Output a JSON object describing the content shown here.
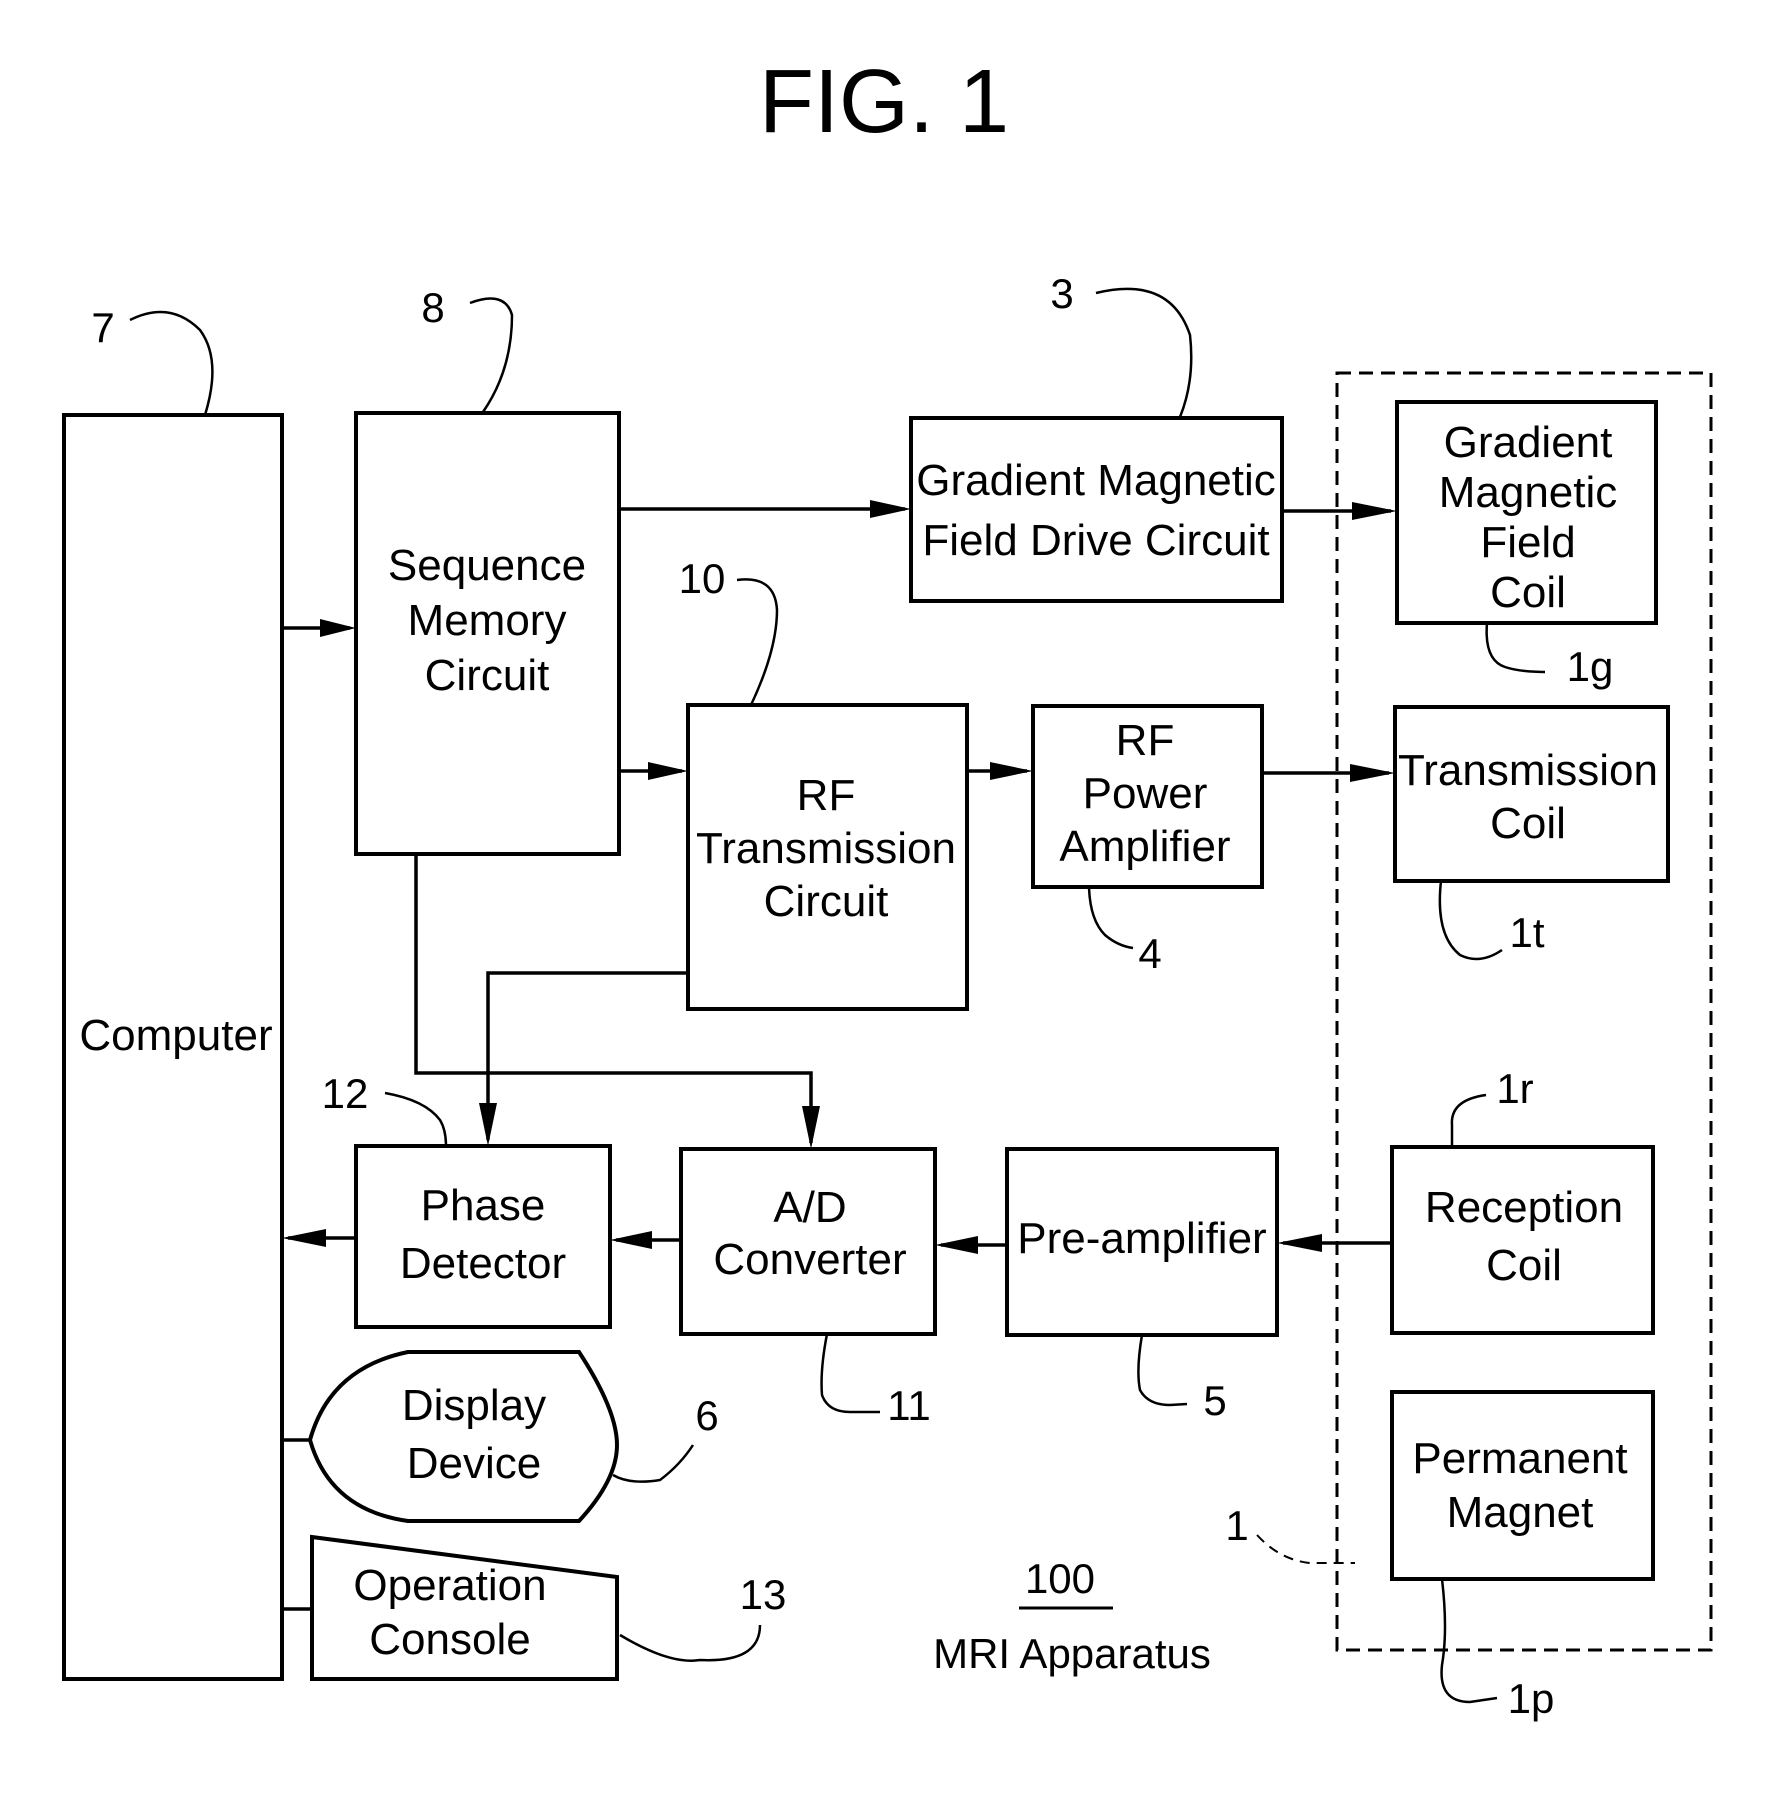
{
  "figure": {
    "title": "FIG. 1",
    "apparatus_number": "100",
    "apparatus_name": "MRI Apparatus"
  },
  "blocks": {
    "computer": {
      "label": [
        "Computer"
      ],
      "ref": "7"
    },
    "sequence_memory": {
      "label": [
        "Sequence",
        "Memory",
        "Circuit"
      ],
      "ref": "8"
    },
    "gradient_drive": {
      "label": [
        "Gradient Magnetic",
        "Field Drive Circuit"
      ],
      "ref": "3"
    },
    "rf_transmission": {
      "label": [
        "RF",
        "Transmission",
        "Circuit"
      ],
      "ref": "10"
    },
    "rf_power_amp": {
      "label": [
        "RF",
        "Power",
        "Amplifier"
      ],
      "ref": "4"
    },
    "gradient_coil": {
      "label": [
        "Gradient",
        "Magnetic",
        "Field",
        "Coil"
      ],
      "ref": "1g"
    },
    "transmission_coil": {
      "label": [
        "Transmission",
        "Coil"
      ],
      "ref": "1t"
    },
    "reception_coil": {
      "label": [
        "Reception",
        "Coil"
      ],
      "ref": "1r"
    },
    "permanent_magnet": {
      "label": [
        "Permanent",
        "Magnet"
      ],
      "ref": "1p"
    },
    "phase_detector": {
      "label": [
        "Phase",
        "Detector"
      ],
      "ref": "12"
    },
    "ad_converter": {
      "label": [
        "A/D",
        "Converter"
      ],
      "ref": "11"
    },
    "preamplifier": {
      "label": [
        "Pre-amplifier"
      ],
      "ref": "5"
    },
    "display_device": {
      "label": [
        "Display",
        "Device"
      ],
      "ref": "6"
    },
    "operation_console": {
      "label": [
        "Operation",
        "Console"
      ],
      "ref": "13"
    },
    "magnet_system": {
      "ref": "1"
    }
  },
  "connections": [
    {
      "from": "computer",
      "to": "sequence_memory"
    },
    {
      "from": "sequence_memory",
      "to": "gradient_drive"
    },
    {
      "from": "gradient_drive",
      "to": "gradient_coil"
    },
    {
      "from": "sequence_memory",
      "to": "rf_transmission"
    },
    {
      "from": "rf_transmission",
      "to": "rf_power_amp"
    },
    {
      "from": "rf_power_amp",
      "to": "transmission_coil"
    },
    {
      "from": "rf_transmission",
      "to": "phase_detector"
    },
    {
      "from": "sequence_memory",
      "to": "ad_converter"
    },
    {
      "from": "reception_coil",
      "to": "preamplifier"
    },
    {
      "from": "preamplifier",
      "to": "ad_converter"
    },
    {
      "from": "ad_converter",
      "to": "phase_detector"
    },
    {
      "from": "phase_detector",
      "to": "computer"
    },
    {
      "from": "computer",
      "to": "display_device"
    },
    {
      "from": "computer",
      "to": "operation_console"
    }
  ]
}
